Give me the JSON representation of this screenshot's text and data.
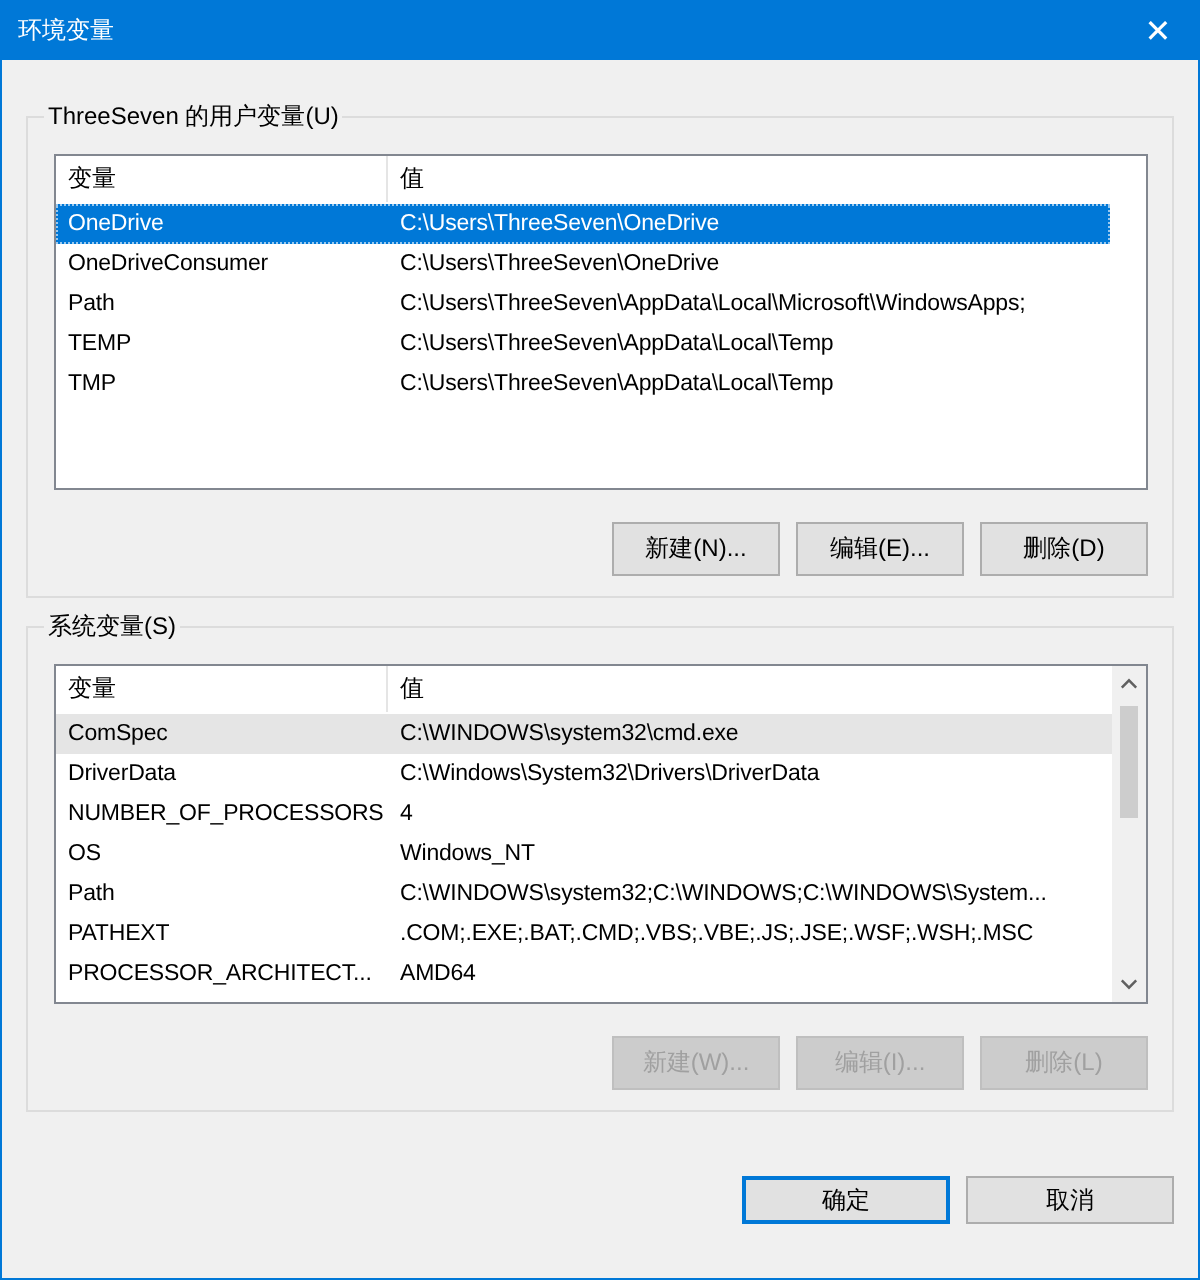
{
  "window": {
    "title": "环境变量",
    "close": "✕"
  },
  "user_vars": {
    "label": "ThreeSeven 的用户变量(U)",
    "focused": true,
    "columns": [
      "变量",
      "值"
    ],
    "rows": [
      {
        "name": "OneDrive",
        "value": "C:\\Users\\ThreeSeven\\OneDrive",
        "selected": true
      },
      {
        "name": "OneDriveConsumer",
        "value": "C:\\Users\\ThreeSeven\\OneDrive",
        "selected": false
      },
      {
        "name": "Path",
        "value": "C:\\Users\\ThreeSeven\\AppData\\Local\\Microsoft\\WindowsApps;",
        "selected": false
      },
      {
        "name": "TEMP",
        "value": "C:\\Users\\ThreeSeven\\AppData\\Local\\Temp",
        "selected": false
      },
      {
        "name": "TMP",
        "value": "C:\\Users\\ThreeSeven\\AppData\\Local\\Temp",
        "selected": false
      }
    ],
    "buttons": [
      {
        "label": "新建(N)...",
        "disabled": false
      },
      {
        "label": "编辑(E)...",
        "disabled": false
      },
      {
        "label": "删除(D)",
        "disabled": false
      }
    ]
  },
  "system_vars": {
    "label": "系统变量(S)",
    "focused": false,
    "columns": [
      "变量",
      "值"
    ],
    "rows": [
      {
        "name": "ComSpec",
        "value": "C:\\WINDOWS\\system32\\cmd.exe",
        "selected": true
      },
      {
        "name": "DriverData",
        "value": "C:\\Windows\\System32\\Drivers\\DriverData",
        "selected": false
      },
      {
        "name": "NUMBER_OF_PROCESSORS",
        "value": "4",
        "selected": false
      },
      {
        "name": "OS",
        "value": "Windows_NT",
        "selected": false
      },
      {
        "name": "Path",
        "value": "C:\\WINDOWS\\system32;C:\\WINDOWS;C:\\WINDOWS\\System...",
        "selected": false
      },
      {
        "name": "PATHEXT",
        "value": ".COM;.EXE;.BAT;.CMD;.VBS;.VBE;.JS;.JSE;.WSF;.WSH;.MSC",
        "selected": false
      },
      {
        "name": "PROCESSOR_ARCHITECT...",
        "value": "AMD64",
        "selected": false
      }
    ],
    "buttons": [
      {
        "label": "新建(W)...",
        "disabled": true
      },
      {
        "label": "编辑(I)...",
        "disabled": true
      },
      {
        "label": "删除(L)",
        "disabled": true
      }
    ]
  },
  "footer_buttons": [
    {
      "label": "确定",
      "default": true
    },
    {
      "label": "取消",
      "default": false
    }
  ]
}
